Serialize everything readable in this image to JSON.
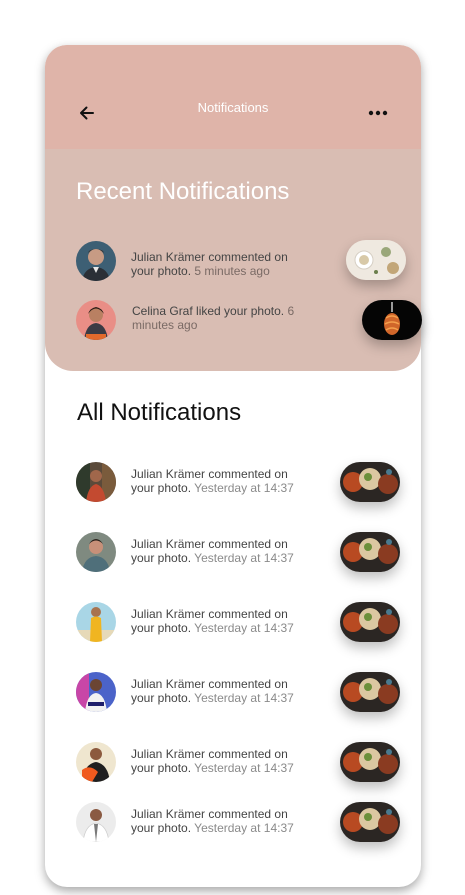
{
  "header": {
    "title": "Notifications"
  },
  "recent": {
    "title": "Recent Notifications",
    "items": [
      {
        "user": "Julian Krämer",
        "action": "commented on your photo.",
        "time": "5 minutes ago"
      },
      {
        "user": "Celina Graf",
        "action": "liked your photo.",
        "time": "6 minutes ago"
      }
    ]
  },
  "all": {
    "title": "All Notifications",
    "items": [
      {
        "user": "Julian Krämer",
        "action": "commented on your photo.",
        "time": "Yesterday at 14:37"
      },
      {
        "user": "Julian Krämer",
        "action": "commented on your photo.",
        "time": "Yesterday at 14:37"
      },
      {
        "user": "Julian Krämer",
        "action": "commented on your photo.",
        "time": "Yesterday at 14:37"
      },
      {
        "user": "Julian Krämer",
        "action": "commented on your photo.",
        "time": "Yesterday at 14:37"
      },
      {
        "user": "Julian Krämer",
        "action": "commented on your photo.",
        "time": "Yesterday at 14:37"
      },
      {
        "user": "Julian Krämer",
        "action": "commented on your photo.",
        "time": "Yesterday at 14:37"
      }
    ]
  },
  "icons": {
    "back": "arrow-left-icon",
    "more": "more-horizontal-icon"
  },
  "colors": {
    "header_bg": "#dfb4a9",
    "panel_bg": "#d9bdb3",
    "card_bg": "#ffffff"
  }
}
